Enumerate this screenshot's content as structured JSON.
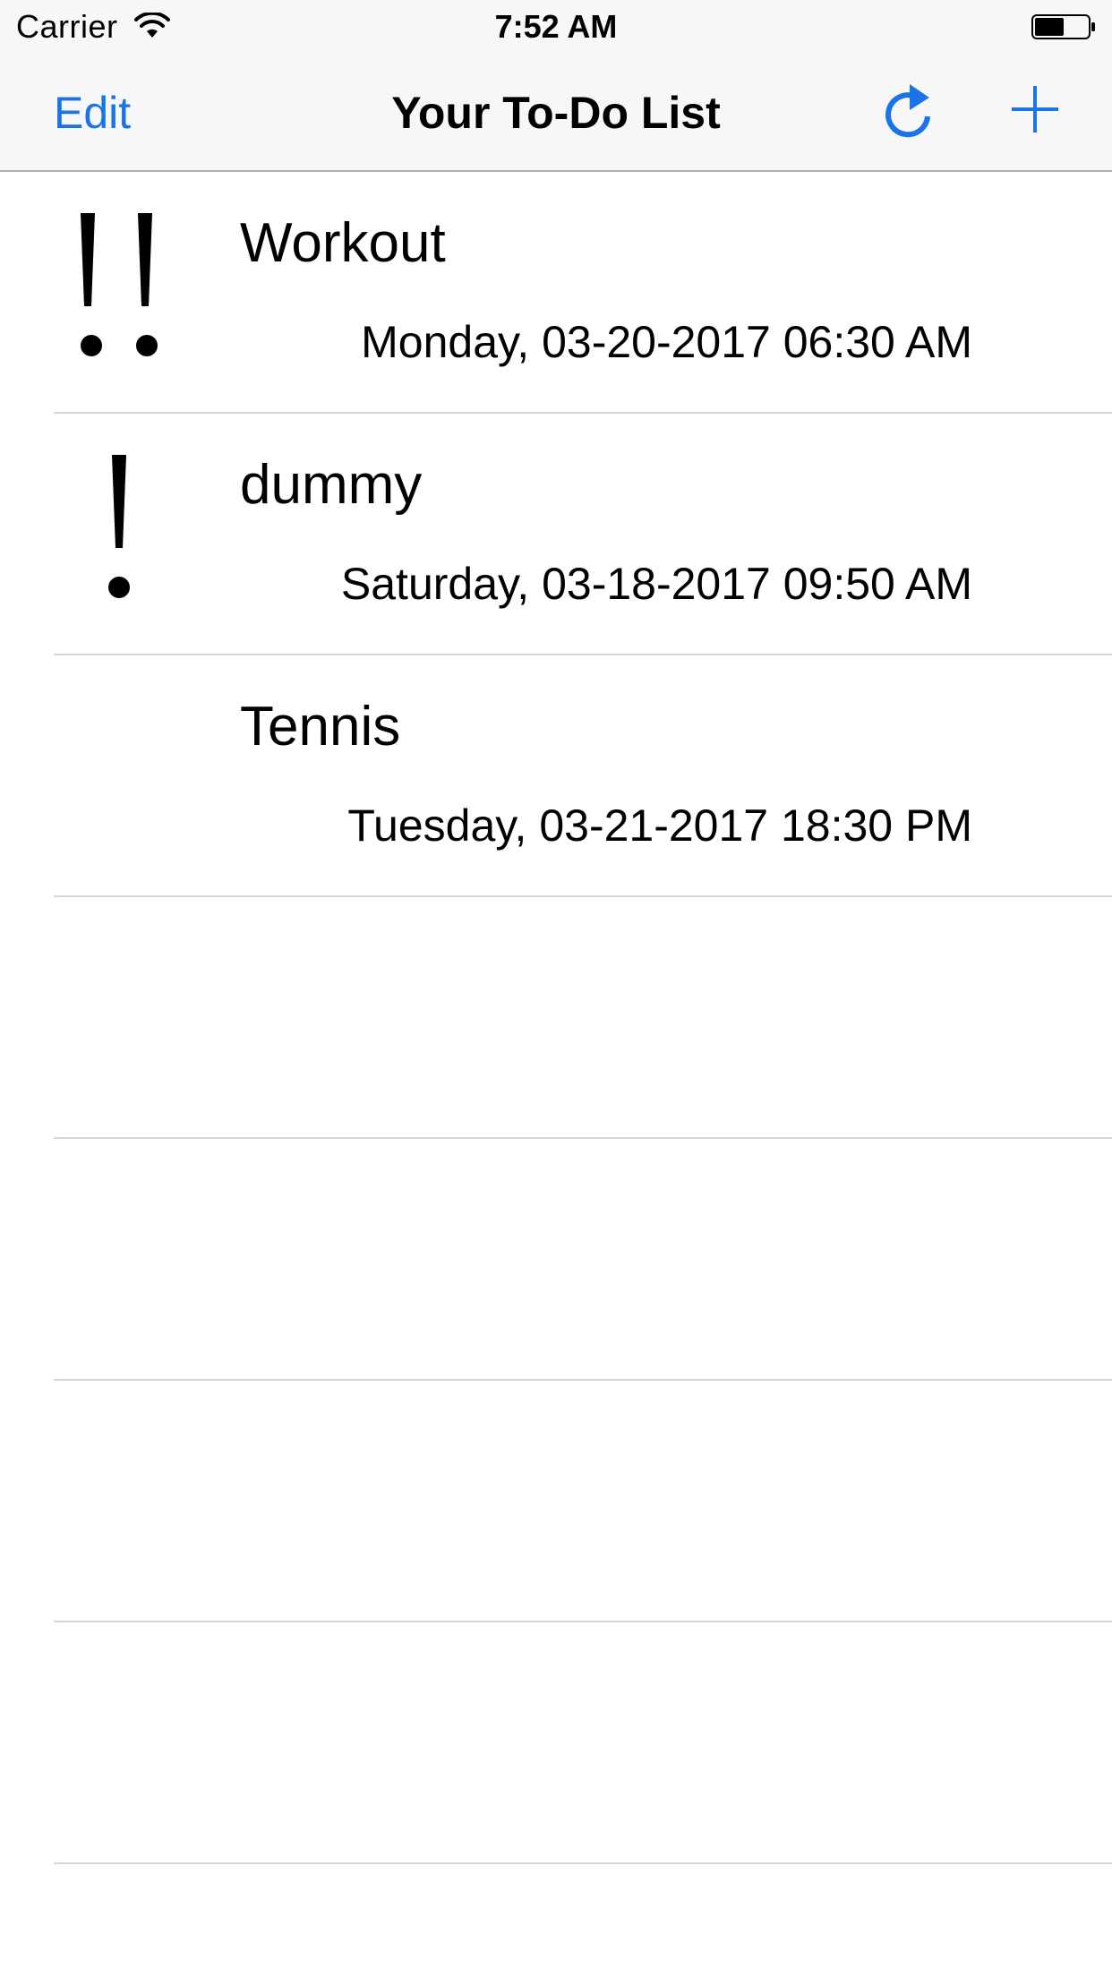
{
  "status_bar": {
    "carrier": "Carrier",
    "time": "7:52 AM",
    "wifi_icon": "wifi-icon",
    "battery_icon": "battery-icon"
  },
  "nav": {
    "edit_label": "Edit",
    "title": "Your To-Do List",
    "refresh_icon": "refresh-icon",
    "add_icon": "plus-icon",
    "accent_color": "#1a73e8"
  },
  "todos": [
    {
      "title": "Workout",
      "date": "Monday, 03-20-2017 06:30 AM",
      "priority": "!!"
    },
    {
      "title": "dummy",
      "date": "Saturday, 03-18-2017 09:50 AM",
      "priority": "!"
    },
    {
      "title": "Tennis",
      "date": "Tuesday, 03-21-2017 18:30 PM",
      "priority": ""
    }
  ]
}
